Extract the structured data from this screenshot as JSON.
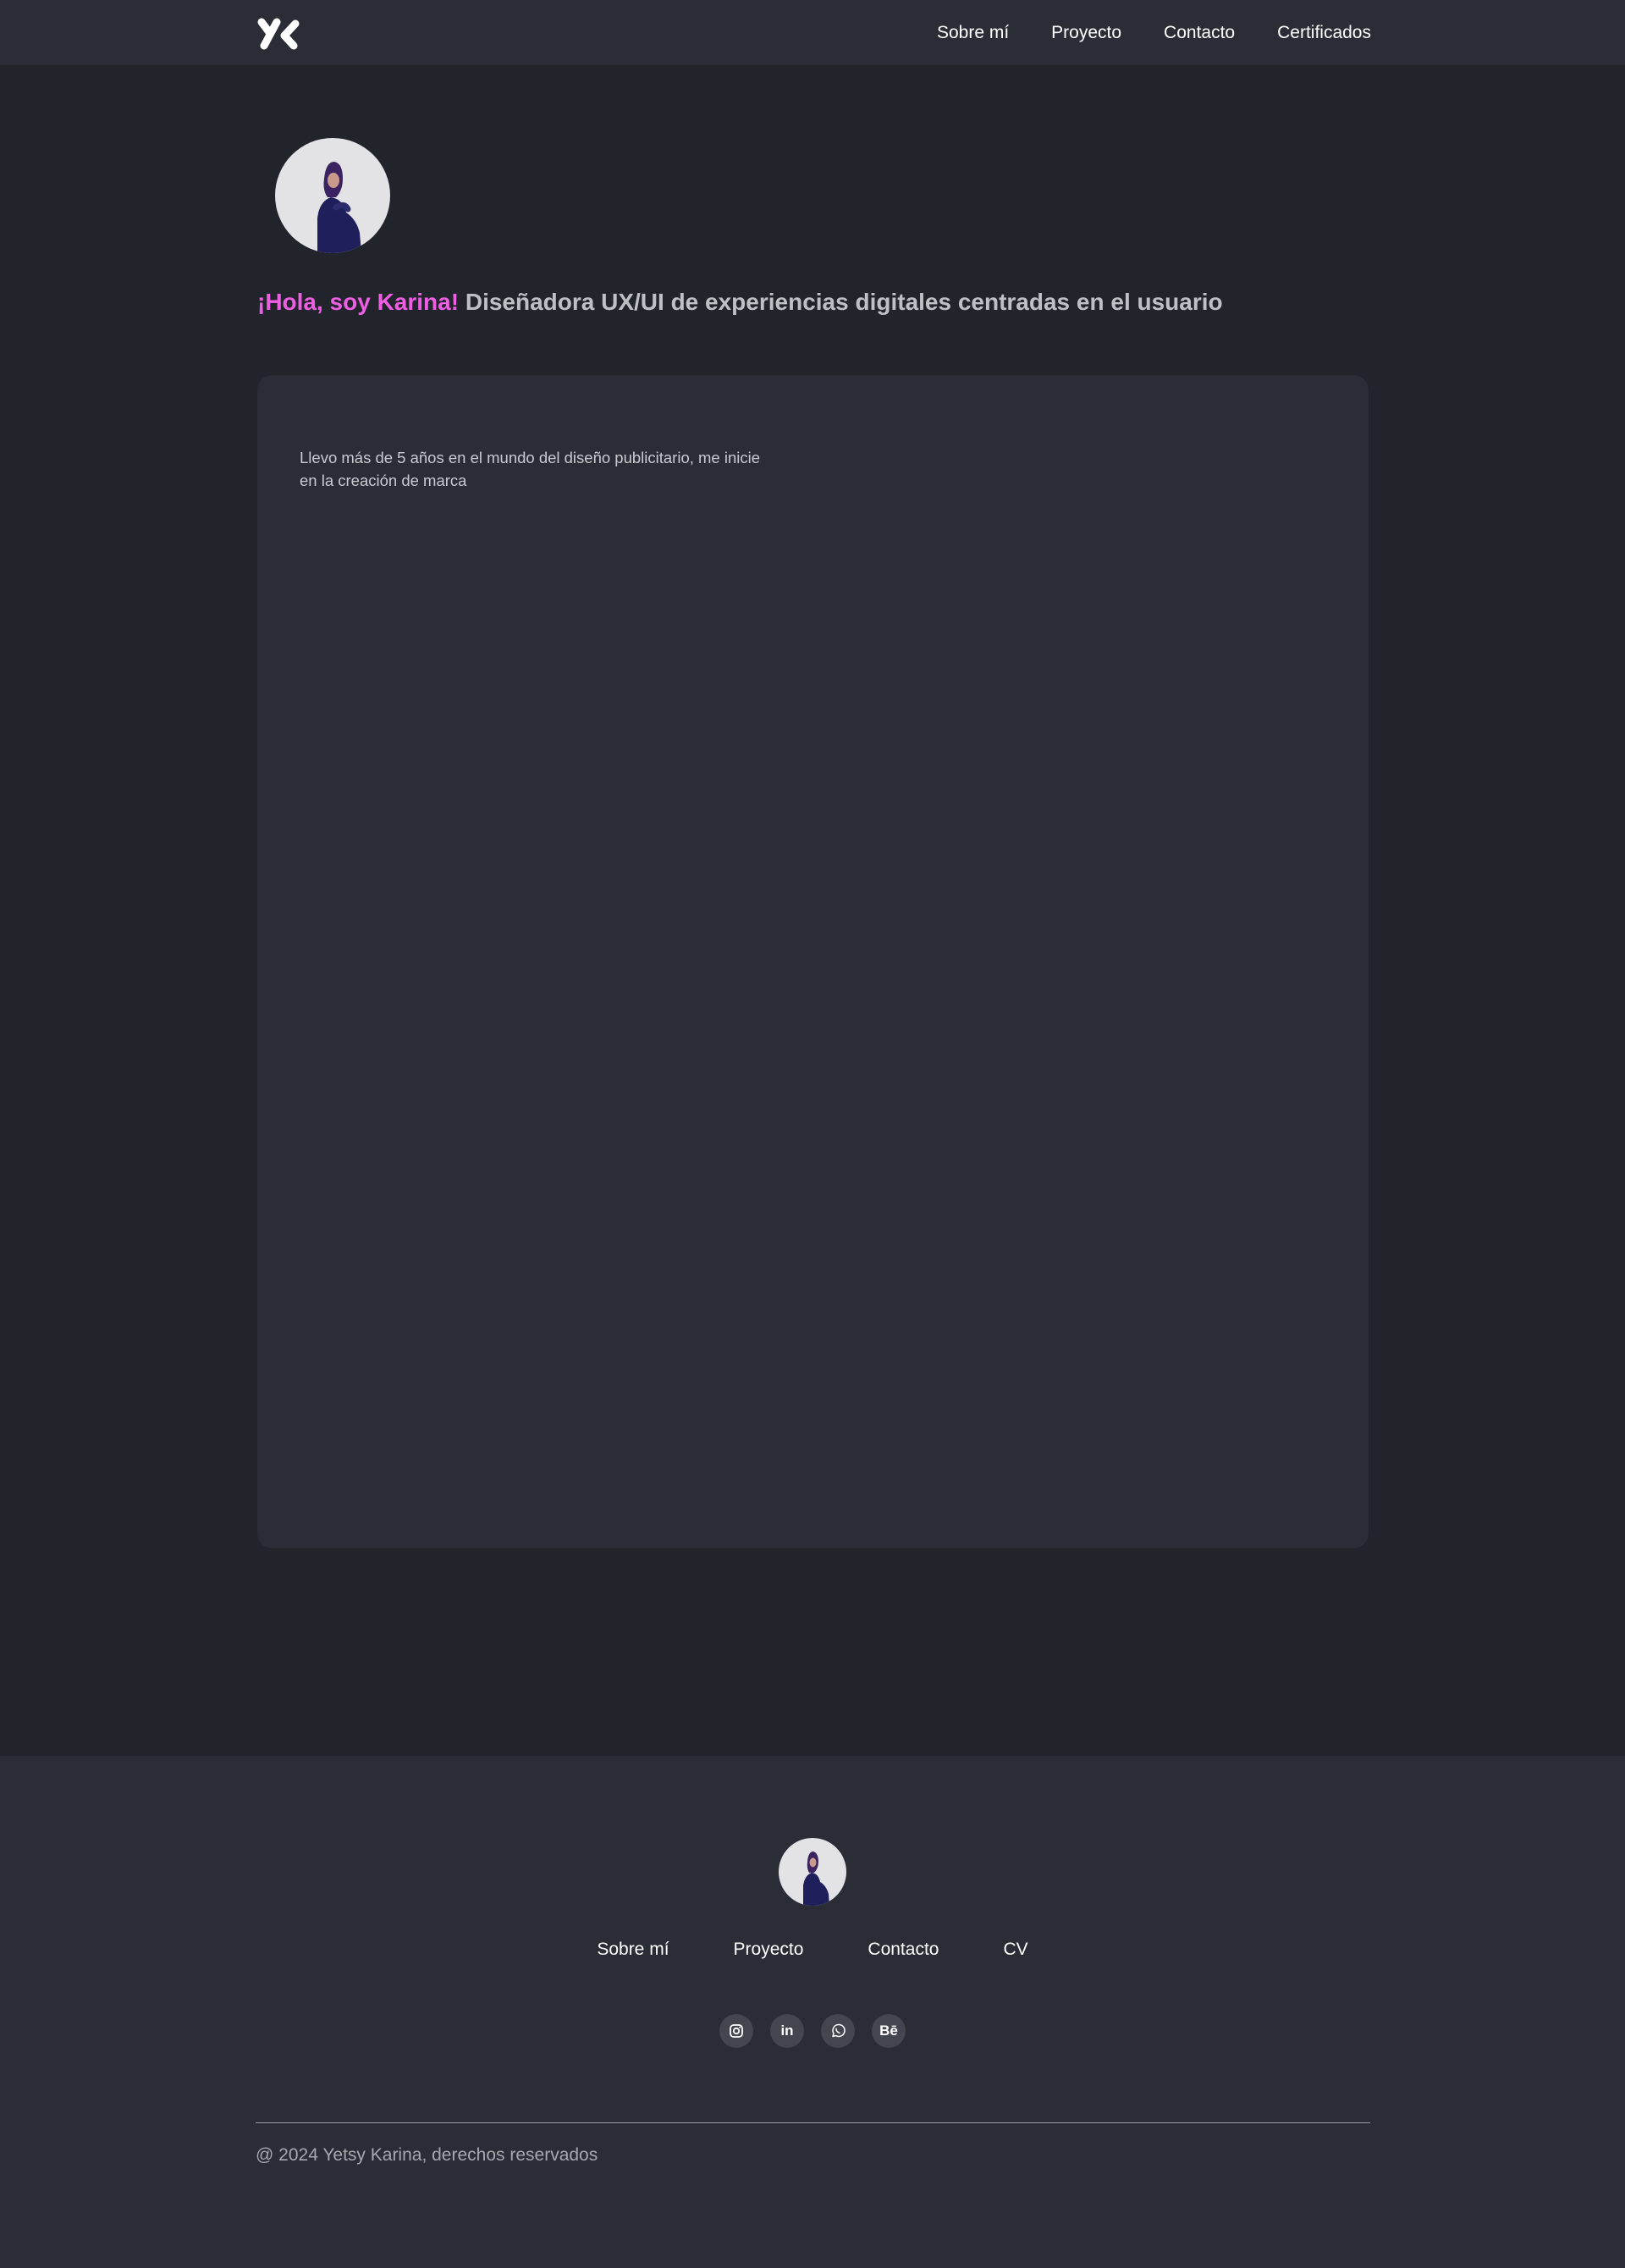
{
  "header": {
    "logo_icon": "yk-monogram-logo",
    "nav": [
      {
        "label": "Sobre mí"
      },
      {
        "label": "Proyecto"
      },
      {
        "label": "Contacto"
      },
      {
        "label": "Certificados"
      }
    ]
  },
  "hero": {
    "greeting": "¡Hola, soy Karina!",
    "tagline": "Diseñadora UX/UI de experiencias digitales centradas en el usuario",
    "accent_color": "#ee5ee3"
  },
  "card": {
    "intro": "Llevo más de 5 años en el mundo del diseño publicitario, me inicie en la creación de marca"
  },
  "footer": {
    "nav": [
      {
        "label": "Sobre mí"
      },
      {
        "label": "Proyecto"
      },
      {
        "label": "Contacto"
      },
      {
        "label": "CV"
      }
    ],
    "socials": [
      {
        "icon": "instagram-icon"
      },
      {
        "icon": "linkedin-icon",
        "text": "in"
      },
      {
        "icon": "whatsapp-icon"
      },
      {
        "icon": "behance-icon",
        "text": "Bē"
      }
    ],
    "copyright": "@ 2024 Yetsy Karina, derechos reservados"
  }
}
